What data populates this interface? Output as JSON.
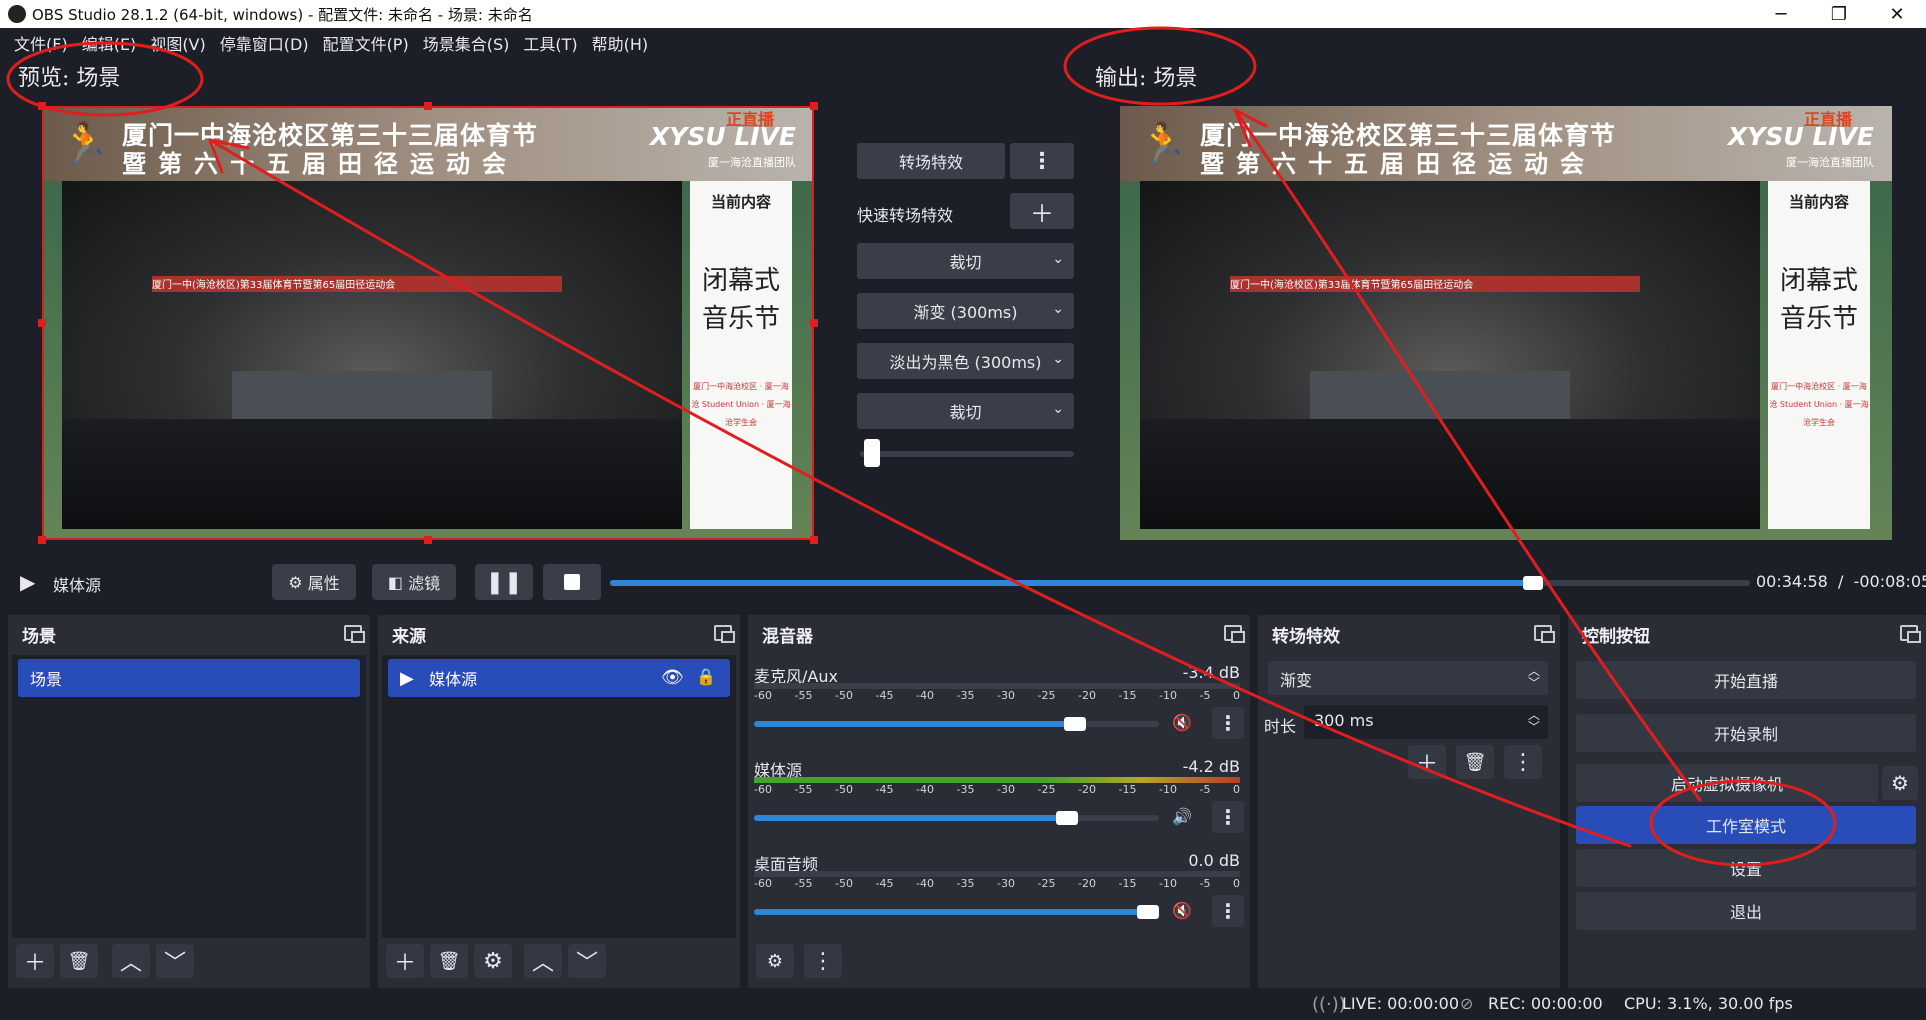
{
  "window": {
    "title": "OBS Studio 28.1.2 (64-bit, windows) - 配置文件: 未命名 - 场景: 未命名",
    "minimize": "─",
    "restore": "❐",
    "close": "✕"
  },
  "menu": [
    "文件(F)",
    "编辑(E)",
    "视图(V)",
    "停靠窗口(D)",
    "配置文件(P)",
    "场景集合(S)",
    "工具(T)",
    "帮助(H)"
  ],
  "preview_label": "预览: 场景",
  "output_label": "输出: 场景",
  "screen": {
    "line1": "厦门一中海沧校区第三十三届体育节",
    "line2": "暨第六十五届田径运动会",
    "live_badge": "正直播",
    "live_name": "XYSU LIVE",
    "team": "厦一海沧直播团队",
    "banner_text": "厦门一中(海沧校区)第33届体育节暨第65届田径运动会",
    "side_top": "当前内容",
    "side_title_1": "闭幕式",
    "side_title_2": "音乐节",
    "side_bottom": "厦门一中海沧校区 · 厦一海沧 Student Union · 厦一海沧学生会"
  },
  "transitions": {
    "transition_label": "转场特效",
    "quick_label": "快速转场特效",
    "items": [
      "裁切",
      "渐变 (300ms)",
      "淡出为黑色 (300ms)",
      "裁切"
    ],
    "tbar_level": 0.02
  },
  "media": {
    "source_name": "媒体源",
    "properties": "属性",
    "filters": "滤镜",
    "elapsed": "00:34:58",
    "separator": "/",
    "remaining": "-00:08:05",
    "progress": 0.81
  },
  "docks": {
    "scenes": {
      "title": "场景",
      "items": [
        "场景"
      ]
    },
    "sources": {
      "title": "来源",
      "items": [
        "媒体源"
      ]
    },
    "mixer": {
      "title": "混音器",
      "scale": [
        "-60",
        "-55",
        "-50",
        "-45",
        "-40",
        "-35",
        "-30",
        "-25",
        "-20",
        "-15",
        "-10",
        "-5",
        "0"
      ],
      "channels": [
        {
          "name": "麦克风/Aux",
          "db": "-3.4 dB",
          "muted": true,
          "level": 0.0,
          "volume": 0.82
        },
        {
          "name": "媒体源",
          "db": "-4.2 dB",
          "muted": false,
          "level": 1.0,
          "volume": 0.8
        },
        {
          "name": "桌面音频",
          "db": "0.0 dB",
          "muted": true,
          "level": 0.0,
          "volume": 1.0
        }
      ]
    },
    "transitions": {
      "title": "转场特效",
      "selected": "渐变",
      "duration_label": "时长",
      "duration_value": "300 ms"
    },
    "controls": {
      "title": "控制按钮",
      "start_stream": "开始直播",
      "start_record": "开始录制",
      "virtual_cam": "启动虚拟摄像机",
      "studio_mode": "工作室模式",
      "settings": "设置",
      "exit": "退出"
    }
  },
  "status": {
    "live": "LIVE: 00:00:00",
    "rec": "REC: 00:00:00",
    "cpu": "CPU: 3.1%, 30.00 fps"
  },
  "colors": {
    "background": "#1c1f27",
    "dock": "#2a2d36",
    "accent": "#284cb8",
    "annotation": "#e01e1e"
  }
}
